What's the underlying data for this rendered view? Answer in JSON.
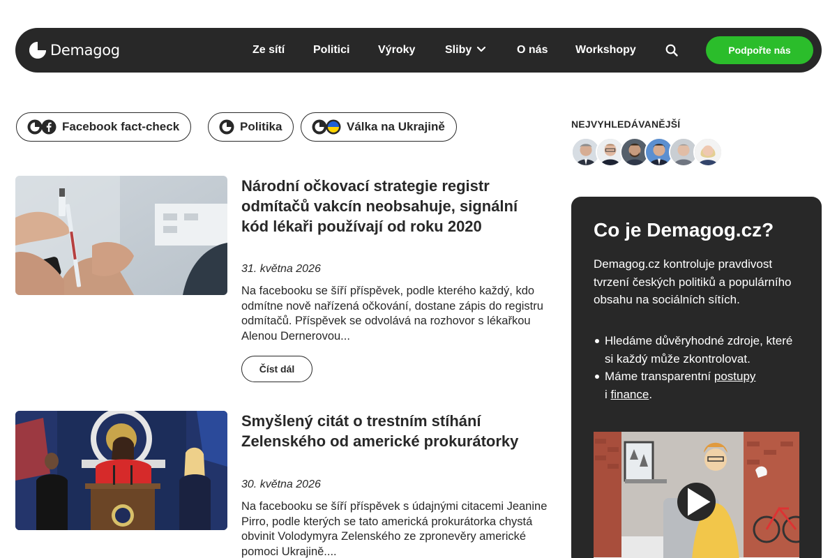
{
  "nav": {
    "logo_text": "Demagog",
    "links": [
      "Ze sítí",
      "Politici",
      "Výroky",
      "Sliby",
      "O nás",
      "Workshopy"
    ],
    "cta_label": "Podpořte nás",
    "icons": [
      "search-icon",
      "chevron-down-icon"
    ]
  },
  "chips": [
    {
      "label": "Facebook fact-check",
      "icons": [
        "demagog-icon",
        "facebook-icon"
      ]
    },
    {
      "label": "Politika",
      "icons": [
        "demagog-icon"
      ]
    },
    {
      "label": "Válka na Ukrajině",
      "icons": [
        "demagog-icon",
        "ukraine-flag-icon"
      ]
    }
  ],
  "articles": [
    {
      "title": "Národní očkovací strategie registr odmítačů vakcín neobsahuje, signální kód lékaři používají od roku 2020",
      "date": "31. května 2026",
      "excerpt": "Na facebooku se šíří příspěvek, podle kterého každý, kdo odmítne nově nařízená očkování, dostane zápis do registru odmítačů. Příspěvek se odvolává na rozhovor s lékařkou Alenou Dernerovou...",
      "read_more": "Číst dál"
    },
    {
      "title": "Smyšlený citát o trestním stíhání Zelenského od americké prokurátorky",
      "date": "30. května 2026",
      "excerpt": "Na facebooku se šíří příspěvek s údajnými citacemi Jeanine Pirro, podle kterých se tato americká prokurátorka chystá obvinit Volodymyra Zelenského ze zpronevěry americké pomoci Ukrajině...."
    }
  ],
  "sidebar": {
    "most_searched_title": "NEJVYHLEDÁVANĚJŠÍ",
    "about": {
      "heading": "Co je Demagog.cz?",
      "intro": "Demagog.cz kontroluje pravdivost tvrzení českých politiků a populárního obsahu na sociálních sítích.",
      "bullet1": "Hledáme důvěryhodné zdroje, které si každý může zkontrolovat.",
      "bullet2_prefix": "Máme transparentní ",
      "bullet2_link1": "postupy",
      "bullet2_mid": " i ",
      "bullet2_link2": "finance",
      "bullet2_suffix": "."
    }
  },
  "colors": {
    "dark": "#282828",
    "accent_green": "#2bbd2b",
    "ukraine_blue": "#1f5fd6",
    "ukraine_yellow": "#ffd400"
  }
}
